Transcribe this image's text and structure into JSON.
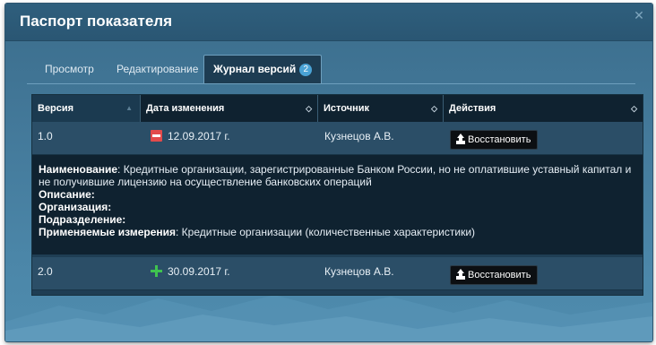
{
  "dialog": {
    "title": "Паспорт показателя",
    "close_icon": "close-icon"
  },
  "tabs": [
    {
      "label": "Просмотр",
      "active": false
    },
    {
      "label": "Редактирование",
      "active": false
    },
    {
      "label": "Журнал версий",
      "active": true,
      "badge": "2"
    }
  ],
  "table": {
    "columns": [
      "Версия",
      "Дата изменения",
      "Источник",
      "Действия"
    ],
    "rows": [
      {
        "version": "1.0",
        "status": "removed",
        "date": "12.09.2017 г.",
        "source": "Кузнецов А.В.",
        "action": "Восстановить"
      },
      {
        "version": "2.0",
        "status": "added",
        "date": "30.09.2017 г.",
        "source": "Кузнецов А.В.",
        "action": "Восстановить"
      }
    ],
    "details": {
      "name_label": "Наименование",
      "name_value_line1": ": Кредитные организации, зарегистрированные Банком России, но не оплатившие уставный капитал и",
      "name_value_line2": "не получившие лицензию на осуществление банковских операций",
      "description_label": "Описание",
      "organization_label": "Организация",
      "department_label": "Подразделение",
      "dimensions_label": "Применяемые измерения",
      "dimensions_value": ": Кредитные организации (количественные характеристики)"
    }
  },
  "colors": {
    "dialog_bg": "#447a9b",
    "header_bg": "#2f5f7d",
    "table_header_bg": "#0f2230",
    "row_bg": "#2b4e67",
    "removed": "#e24b4b",
    "added": "#3fc34f",
    "badge": "#4aa3d6"
  }
}
